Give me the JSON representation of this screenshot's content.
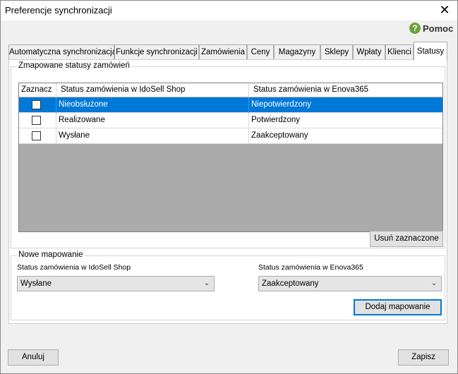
{
  "window": {
    "title": "Preferencje synchronizacji",
    "close_glyph": "✕"
  },
  "help": {
    "icon_glyph": "?",
    "label": "Pomoc"
  },
  "tabs": [
    {
      "label": "Automatyczna synchronizacja"
    },
    {
      "label": "Funkcje synchronizacji"
    },
    {
      "label": "Zamówienia"
    },
    {
      "label": "Ceny"
    },
    {
      "label": "Magazyny"
    },
    {
      "label": "Sklepy"
    },
    {
      "label": "Wpłaty"
    },
    {
      "label": "Klienci"
    },
    {
      "label": "Statusy"
    }
  ],
  "active_tab": "Statusy",
  "mapped": {
    "legend": "Zmapowane statusy zamówień",
    "columns": {
      "select": "Zaznacz",
      "idosell": "Status zamówienia w IdoSell Shop",
      "enova": "Status zamówienia w Enova365"
    },
    "rows": [
      {
        "checked": false,
        "selected": true,
        "idosell": "Nieobsłużone",
        "enova": "Niepotwierdzony"
      },
      {
        "checked": false,
        "selected": false,
        "idosell": "Realizowane",
        "enova": "Potwierdzony"
      },
      {
        "checked": false,
        "selected": false,
        "idosell": "Wysłane",
        "enova": "Zaakceptowany"
      }
    ],
    "delete_button": "Usuń zaznaczone"
  },
  "new_mapping": {
    "legend": "Nowe mapowanie",
    "idosell_label": "Status zamówienia w IdoSell Shop",
    "idosell_value": "Wysłane",
    "enova_label": "Status zamówienia w Enova365",
    "enova_value": "Zaakceptowany",
    "add_button": "Dodaj mapowanie"
  },
  "footer": {
    "cancel_button": "Anuluj",
    "save_button": "Zapisz"
  },
  "colors": {
    "selection": "#0078d7",
    "help_icon": "#6aa33a"
  }
}
